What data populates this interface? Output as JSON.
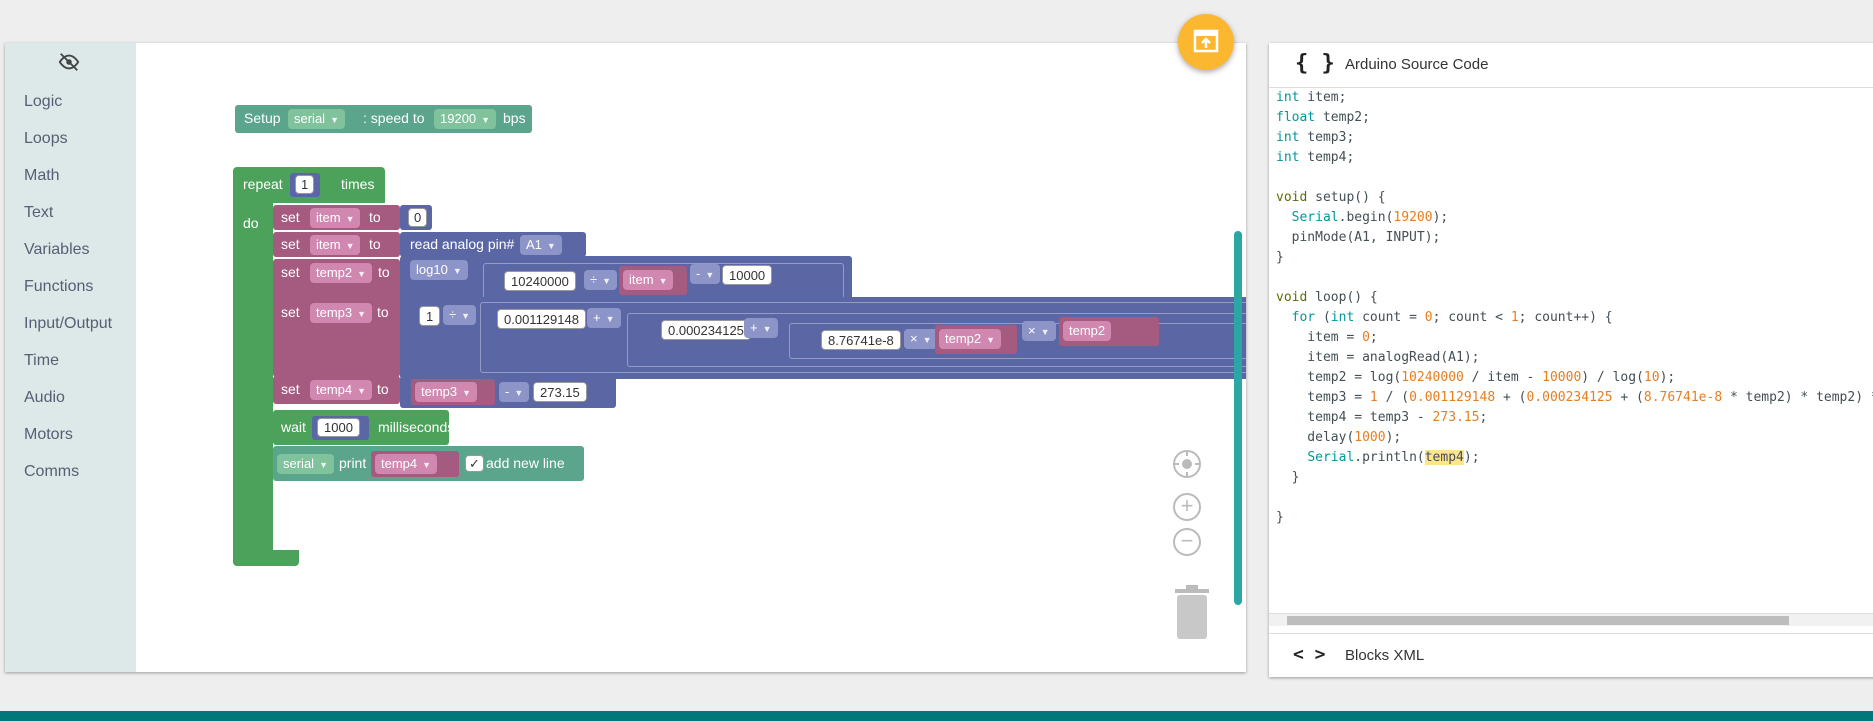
{
  "toolbox": {
    "categories": [
      "Logic",
      "Loops",
      "Math",
      "Text",
      "Variables",
      "Functions",
      "Input/Output",
      "Time",
      "Audio",
      "Motors",
      "Comms"
    ],
    "visibility_icon": "eye-off-icon"
  },
  "blocks": {
    "setup_serial": {
      "prefix": "Setup",
      "port": "serial",
      "middle": ": speed to",
      "speed": "19200",
      "suffix": "bps"
    },
    "repeat": {
      "label": "repeat",
      "times_value": "1",
      "times_label": "times",
      "do_label": "do"
    },
    "set_item0": {
      "set": "set",
      "var": "item",
      "to": "to",
      "value": "0"
    },
    "set_item_read": {
      "set": "set",
      "var": "item",
      "to": "to",
      "read_label": "read analog pin#",
      "pin": "A1"
    },
    "set_temp2": {
      "set": "set",
      "var": "temp2",
      "to": "to",
      "func": "log10",
      "num": "10240000",
      "op1": "÷",
      "var2": "item",
      "op2": "-",
      "num2": "10000"
    },
    "set_temp3": {
      "set": "set",
      "var": "temp3",
      "to": "to",
      "one": "1",
      "op_div": "÷",
      "a": "0.001129148",
      "plus1": "+",
      "b": "0.000234125",
      "plus2": "+",
      "c": "8.76741e-8",
      "times1": "×",
      "v1": "temp2",
      "times2": "×",
      "v2": "temp2"
    },
    "set_temp4": {
      "set": "set",
      "var": "temp4",
      "to": "to",
      "v": "temp3",
      "op": "-",
      "num": "273.15"
    },
    "wait": {
      "label": "wait",
      "value": "1000",
      "unit": "milliseconds"
    },
    "serial_print": {
      "port": "serial",
      "label": "print",
      "var": "temp4",
      "check": "✓",
      "newline": "add new line"
    }
  },
  "code_panel": {
    "title": "Arduino Source Code",
    "icon": "braces-icon",
    "footer_title": "Blocks XML",
    "footer_icon": "code-brackets-icon"
  },
  "colors": {
    "loop_green": "#4ca25a",
    "math_blue": "#5b67a5",
    "var_pink": "#a55b80",
    "serial_teal": "#5ba58c",
    "accent_teal": "#2aa6a4",
    "fab_yellow": "#fcb731",
    "bottom_bar": "#00787a"
  }
}
